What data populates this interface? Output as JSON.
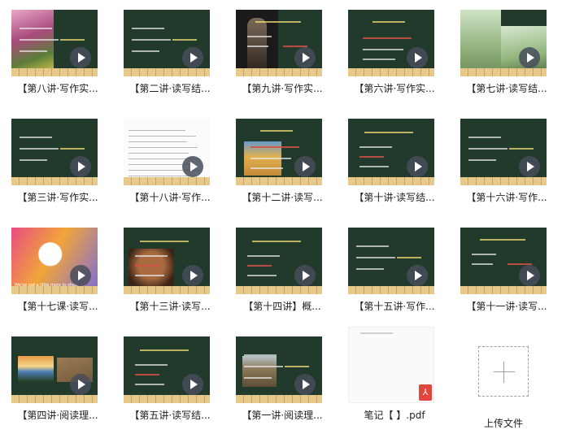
{
  "files": [
    {
      "label": "【第八讲·写作实...",
      "thumb": "flowers"
    },
    {
      "label": "【第二讲·读写结...",
      "thumb": "board"
    },
    {
      "label": "【第九讲·写作实...",
      "thumb": "warrior"
    },
    {
      "label": "【第六讲·写作实...",
      "thumb": "board"
    },
    {
      "label": "【第七讲·读写结...",
      "thumb": "willow"
    },
    {
      "label": "【第三讲·写作实...",
      "thumb": "board"
    },
    {
      "label": "【第十八讲·写作...",
      "thumb": "document"
    },
    {
      "label": "【第十二讲·读写...",
      "thumb": "painting"
    },
    {
      "label": "【第十讲·读写结...",
      "thumb": "board"
    },
    {
      "label": "【第十六讲·写作...",
      "thumb": "board"
    },
    {
      "label": "【第十七课·读写...",
      "thumb": "apple"
    },
    {
      "label": "【第十三讲·读写...",
      "thumb": "face"
    },
    {
      "label": "【第十四讲】概...",
      "thumb": "board"
    },
    {
      "label": "【第十五讲·写作...",
      "thumb": "board"
    },
    {
      "label": "【第十一讲·读写...",
      "thumb": "board"
    },
    {
      "label": "【第四讲·阅读理...",
      "thumb": "landscape"
    },
    {
      "label": "【第五讲·读写结...",
      "thumb": "board"
    },
    {
      "label": "【第一讲·阅读理...",
      "thumb": "soldiers"
    },
    {
      "label": "笔记【 】.pdf",
      "thumb": "pdf"
    }
  ],
  "upload": {
    "label": "上传文件"
  },
  "apple_caption": "We've got a little more to show",
  "pdf_badge": "⅄"
}
